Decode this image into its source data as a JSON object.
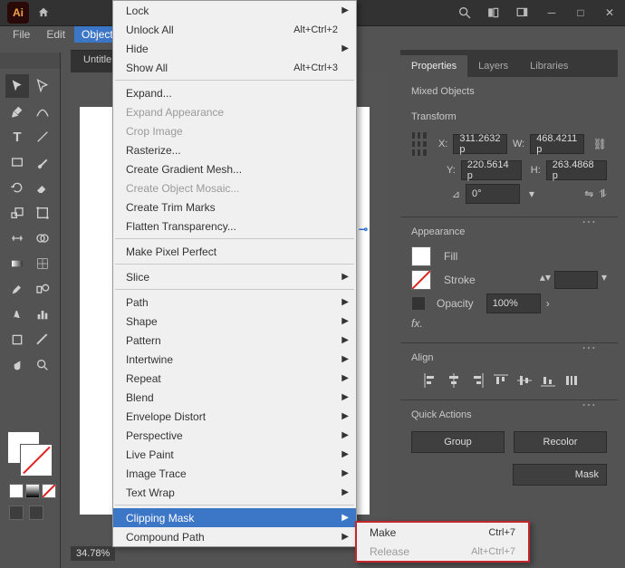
{
  "app": {
    "logo": "Ai"
  },
  "menubar": [
    "File",
    "Edit",
    "Object"
  ],
  "doc_tab": "Untitle",
  "zoom": "34.78%",
  "context_menu": {
    "items": [
      {
        "label": "Lock",
        "sub": true
      },
      {
        "label": "Unlock All",
        "shortcut": "Alt+Ctrl+2"
      },
      {
        "label": "Hide",
        "sub": true
      },
      {
        "label": "Show All",
        "shortcut": "Alt+Ctrl+3"
      },
      {
        "sep": true
      },
      {
        "label": "Expand..."
      },
      {
        "label": "Expand Appearance",
        "disabled": true
      },
      {
        "label": "Crop Image",
        "disabled": true
      },
      {
        "label": "Rasterize..."
      },
      {
        "label": "Create Gradient Mesh..."
      },
      {
        "label": "Create Object Mosaic...",
        "disabled": true
      },
      {
        "label": "Create Trim Marks"
      },
      {
        "label": "Flatten Transparency..."
      },
      {
        "sep": true
      },
      {
        "label": "Make Pixel Perfect"
      },
      {
        "sep": true
      },
      {
        "label": "Slice",
        "sub": true
      },
      {
        "sep": true
      },
      {
        "label": "Path",
        "sub": true
      },
      {
        "label": "Shape",
        "sub": true
      },
      {
        "label": "Pattern",
        "sub": true
      },
      {
        "label": "Intertwine",
        "sub": true
      },
      {
        "label": "Repeat",
        "sub": true
      },
      {
        "label": "Blend",
        "sub": true
      },
      {
        "label": "Envelope Distort",
        "sub": true
      },
      {
        "label": "Perspective",
        "sub": true
      },
      {
        "label": "Live Paint",
        "sub": true
      },
      {
        "label": "Image Trace",
        "sub": true
      },
      {
        "label": "Text Wrap",
        "sub": true
      },
      {
        "sep": true
      },
      {
        "label": "Clipping Mask",
        "sub": true,
        "highlight": true
      },
      {
        "label": "Compound Path",
        "sub": true
      }
    ]
  },
  "submenu": {
    "items": [
      {
        "label": "Make",
        "shortcut": "Ctrl+7"
      },
      {
        "label": "Release",
        "shortcut": "Alt+Ctrl+7",
        "disabled": true
      }
    ]
  },
  "panel": {
    "tabs": [
      "Properties",
      "Layers",
      "Libraries"
    ],
    "selection": "Mixed Objects",
    "transform": {
      "title": "Transform",
      "x": "311.2632 p",
      "y": "220.5614 p",
      "w": "468.4211 p",
      "h": "263.4868 p",
      "angle_label": "⊿",
      "angle": "0°"
    },
    "appearance": {
      "title": "Appearance",
      "fill": "Fill",
      "stroke": "Stroke",
      "opacity_label": "Opacity",
      "opacity": "100%",
      "fx": "fx."
    },
    "align": {
      "title": "Align"
    },
    "quick": {
      "title": "Quick Actions",
      "group": "Group",
      "recolor": "Recolor",
      "mask_partial": "Mask"
    }
  }
}
